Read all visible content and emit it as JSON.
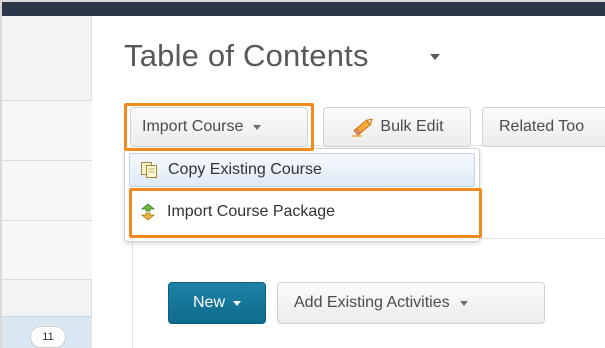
{
  "page": {
    "title": "Table of Contents"
  },
  "sidebar": {
    "badge": "11"
  },
  "toolbar": {
    "import_course_label": "Import Course",
    "bulk_edit_label": "Bulk Edit",
    "related_tools_label": "Related Too"
  },
  "import_menu": {
    "items": [
      {
        "label": "Copy Existing Course",
        "icon": "copy-document-icon"
      },
      {
        "label": "Import Course Package",
        "icon": "import-arrows-icon"
      }
    ]
  },
  "content": {
    "new_label": "New",
    "add_existing_label": "Add Existing Activities"
  },
  "colors": {
    "highlight": "#f28a1e",
    "primary_button": "#0e6b8c",
    "top_bar": "#2b3648"
  }
}
